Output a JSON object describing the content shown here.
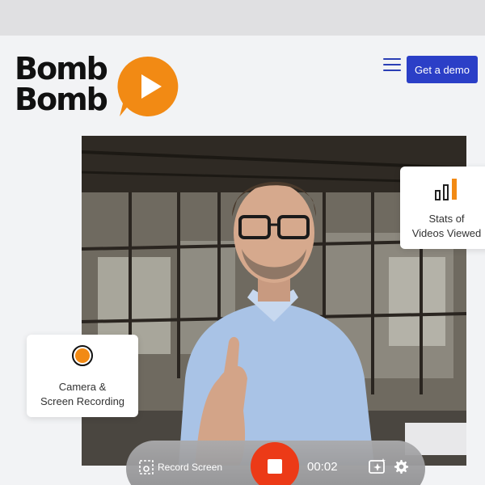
{
  "header": {
    "logo_line1": "Bomb",
    "logo_line2": "Bomb",
    "demo_label": "Get a demo"
  },
  "cards": {
    "stats_line1": "Stats of",
    "stats_line2": "Videos Viewed",
    "camera_line1": "Camera &",
    "camera_line2": "Screen Recording"
  },
  "recorder": {
    "record_screen_label": "Record Screen",
    "timer": "00:02"
  },
  "icons": {
    "menu": "hamburger-menu-icon",
    "logo": "play-bubble-icon",
    "stats": "bar-chart-icon",
    "camera": "record-dot-icon",
    "record_screen": "screen-capture-icon",
    "stop": "stop-icon",
    "effects": "sparkle-icon",
    "settings": "gear-icon"
  },
  "colors": {
    "brand_orange": "#f28a14",
    "button_blue": "#2b3fc7",
    "record_red": "#ec3a17"
  }
}
